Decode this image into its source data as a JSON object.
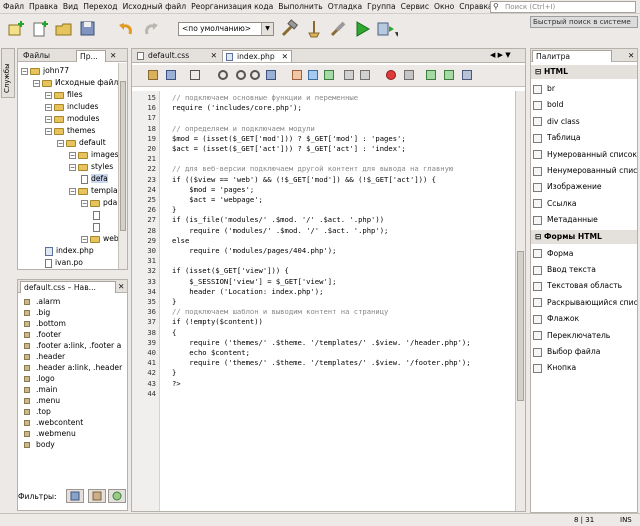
{
  "menu": [
    "Файл",
    "Правка",
    "Вид",
    "Переход",
    "Исходный файл",
    "Реорганизация кода",
    "Выполнить",
    "Отладка",
    "Группа",
    "Сервис",
    "Окно",
    "Справка"
  ],
  "search": {
    "placeholder": "Поиск (Ctrl+I)",
    "tooltip": "Быстрый поиск в системе"
  },
  "toolbar": {
    "config": "<по умолчанию>"
  },
  "side_tab": "Службы",
  "projects_panel": {
    "tabs": [
      "Файлы",
      "Пр..."
    ],
    "tree": [
      {
        "label": "john77",
        "type": "project",
        "indent": 0
      },
      {
        "label": "Исходные файлы",
        "type": "folder",
        "indent": 1
      },
      {
        "label": "files",
        "type": "folder",
        "indent": 2
      },
      {
        "label": "includes",
        "type": "folder",
        "indent": 2
      },
      {
        "label": "modules",
        "type": "folder",
        "indent": 2
      },
      {
        "label": "themes",
        "type": "folder",
        "indent": 2
      },
      {
        "label": "default",
        "type": "folder",
        "indent": 3
      },
      {
        "label": "images",
        "type": "folder",
        "indent": 4
      },
      {
        "label": "styles",
        "type": "folder",
        "indent": 4
      },
      {
        "label": "defa",
        "type": "css",
        "indent": 5
      },
      {
        "label": "templa",
        "type": "folder",
        "indent": 4
      },
      {
        "label": "pda",
        "type": "folder",
        "indent": 5
      },
      {
        "label": "",
        "type": "file",
        "indent": 6
      },
      {
        "label": "",
        "type": "file",
        "indent": 6
      },
      {
        "label": "web",
        "type": "folder",
        "indent": 5
      },
      {
        "label": "index.php",
        "type": "php",
        "indent": 2
      },
      {
        "label": "ivan.po",
        "type": "file",
        "indent": 2
      }
    ]
  },
  "navigator_panel": {
    "title": "default.css – Нав...",
    "items": [
      ".alarm",
      ".big",
      ".bottom",
      ".footer",
      ".footer a:link, .footer a",
      ".header",
      ".header a:link, .header",
      ".logo",
      ".main",
      ".menu",
      ".top",
      ".webcontent",
      ".webmenu",
      "body"
    ],
    "filters_label": "Фильтры:"
  },
  "editor": {
    "tabs": [
      "default.css",
      "index.php"
    ],
    "lines": [
      {
        "n": "15",
        "text": "// подключаем основные функции и переменные"
      },
      {
        "n": "16",
        "text": "require ('includes/core.php');"
      },
      {
        "n": "17",
        "text": ""
      },
      {
        "n": "18",
        "text": "// определяем и подключаем модули"
      },
      {
        "n": "19",
        "text": "$mod = (isset($_GET['mod'])) ? $_GET['mod'] : 'pages';"
      },
      {
        "n": "20",
        "text": "$act = (isset($_GET['act'])) ? $_GET['act'] : 'index';"
      },
      {
        "n": "21",
        "text": ""
      },
      {
        "n": "22",
        "text": "// для веб-версии подключаем другой контент для вывода на главную"
      },
      {
        "n": "23",
        "text": "if (($view == 'web') && (!$_GET['mod']) && (!$_GET['act'])) {"
      },
      {
        "n": "24",
        "text": "    $mod = 'pages';"
      },
      {
        "n": "25",
        "text": "    $act = 'webpage';"
      },
      {
        "n": "26",
        "text": "}"
      },
      {
        "n": "27",
        "text": "if (is_file('modules/' .$mod. '/' .$act. '.php'))"
      },
      {
        "n": "28",
        "text": "    require ('modules/' .$mod. '/' .$act. '.php');"
      },
      {
        "n": "29",
        "text": "else"
      },
      {
        "n": "30",
        "text": "    require ('modules/pages/404.php');"
      },
      {
        "n": "31",
        "text": ""
      },
      {
        "n": "32",
        "text": "if (isset($_GET['view'])) {"
      },
      {
        "n": "33",
        "text": "    $_SESSION['view'] = $_GET['view'];"
      },
      {
        "n": "34",
        "text": "    header ('Location: index.php');"
      },
      {
        "n": "35",
        "text": "}"
      },
      {
        "n": "36",
        "text": "// подключаем шаблон и выводим контент на страницу"
      },
      {
        "n": "37",
        "text": "if (!empty($content))"
      },
      {
        "n": "38",
        "text": "{"
      },
      {
        "n": "39",
        "text": "    require ('themes/' .$theme. '/templates/' .$view. '/header.php');"
      },
      {
        "n": "40",
        "text": "    echo $content;"
      },
      {
        "n": "41",
        "text": "    require ('themes/' .$theme. '/templates/' .$view. '/footer.php');"
      },
      {
        "n": "42",
        "text": "}"
      },
      {
        "n": "43",
        "text": "?>"
      },
      {
        "n": "44",
        "text": ""
      }
    ]
  },
  "palette": {
    "title": "Палитра",
    "categories": [
      {
        "name": "HTML",
        "items": [
          {
            "label": "br",
            "icon": "br-icon"
          },
          {
            "label": "bold",
            "icon": "bold-icon"
          },
          {
            "label": "div class",
            "icon": "div-icon"
          },
          {
            "label": "Таблица",
            "icon": "table-icon"
          },
          {
            "label": "Нумерованный список",
            "icon": "ordered-list-icon"
          },
          {
            "label": "Ненумерованный список",
            "icon": "unordered-list-icon"
          },
          {
            "label": "Изображение",
            "icon": "image-icon"
          },
          {
            "label": "Ссылка",
            "icon": "link-icon"
          },
          {
            "label": "Метаданные",
            "icon": "metadata-icon"
          }
        ]
      },
      {
        "name": "Формы HTML",
        "items": [
          {
            "label": "Форма",
            "icon": "form-icon"
          },
          {
            "label": "Ввод текста",
            "icon": "text-input-icon"
          },
          {
            "label": "Текстовая область",
            "icon": "textarea-icon"
          },
          {
            "label": "Раскрывающийся список",
            "icon": "dropdown-icon"
          },
          {
            "label": "Флажок",
            "icon": "checkbox-icon"
          },
          {
            "label": "Переключатель",
            "icon": "radio-icon"
          },
          {
            "label": "Выбор файла",
            "icon": "file-chooser-icon"
          },
          {
            "label": "Кнопка",
            "icon": "button-icon"
          }
        ]
      }
    ]
  },
  "status": {
    "position": "8 | 31",
    "mode": "INS"
  },
  "colors": {
    "folder": "#e6c35c",
    "comment": "#888888",
    "string": "#b8480a",
    "run": "#2fa82f"
  }
}
